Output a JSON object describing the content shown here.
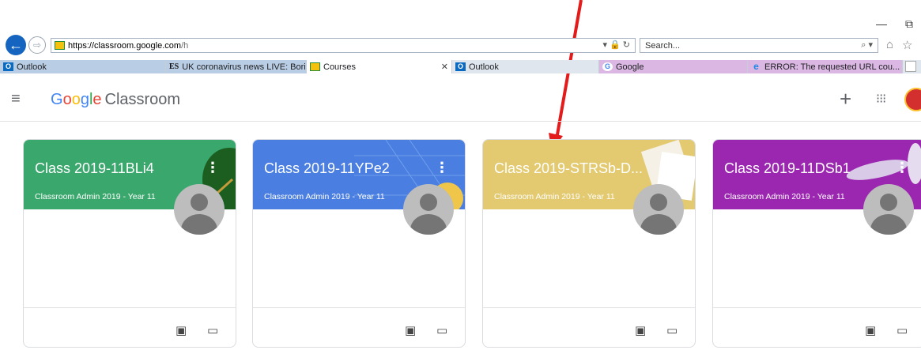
{
  "window": {
    "minimize": "—",
    "restore": "⧉"
  },
  "browser": {
    "url_host": "https://classroom.google.com",
    "url_path": "/h",
    "search_placeholder": "Search...",
    "tabs": [
      {
        "label": "Outlook",
        "icon": "outlook-icon"
      },
      {
        "label": "UK coronavirus news LIVE: Bori...",
        "icon": "es-icon",
        "icon_text": "ES"
      },
      {
        "label": "Courses",
        "icon": "classroom-icon"
      },
      {
        "label": "Outlook",
        "icon": "outlook-icon"
      },
      {
        "label": "Google",
        "icon": "google-icon",
        "icon_text": "G"
      },
      {
        "label": "ERROR: The requested URL cou...",
        "icon": "ie-icon"
      }
    ]
  },
  "app": {
    "logo_google": [
      "G",
      "o",
      "o",
      "g",
      "l",
      "e"
    ],
    "logo_product": "Classroom"
  },
  "cards": [
    {
      "title": "Class 2019-11BLi4",
      "subtitle": "Classroom Admin 2019 - Year 11",
      "color": "#3aa76d"
    },
    {
      "title": "Class 2019-11YPe2",
      "subtitle": "Classroom Admin 2019 - Year 11",
      "color": "#4a7ee0"
    },
    {
      "title": "Class 2019-STRSb-D...",
      "subtitle": "Classroom Admin 2019 - Year 11",
      "color": "#e3c96f"
    },
    {
      "title": "Class 2019-11DSb1",
      "subtitle": "Classroom Admin 2019 - Year 11",
      "color": "#9b27b0"
    }
  ],
  "colors": {
    "arrow": "#e31b1b",
    "accent": "#1a73e8"
  }
}
